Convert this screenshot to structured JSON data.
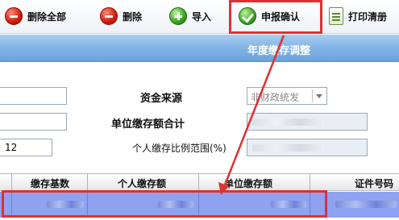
{
  "toolbar": {
    "delete_all_label": "删除全部",
    "delete_label": "删除",
    "import_label": "导入",
    "confirm_label": "申报确认",
    "print_label": "打印清册"
  },
  "panel": {
    "title": "年度缴存调整"
  },
  "form": {
    "fund_source_label": "资金来源",
    "fund_source_value": "非财政统发",
    "unit_total_label": "单位缴存额合计",
    "ratio_value": "12",
    "personal_ratio_label": "个人缴存比例范围(%)"
  },
  "grid": {
    "columns": [
      "缴存基数",
      "个人缴存额",
      "单位缴存额",
      "证件号码"
    ]
  },
  "colors": {
    "highlight": "#e03030",
    "selected_row": "#8ea2f0",
    "title_band": "#7fb2e6"
  }
}
